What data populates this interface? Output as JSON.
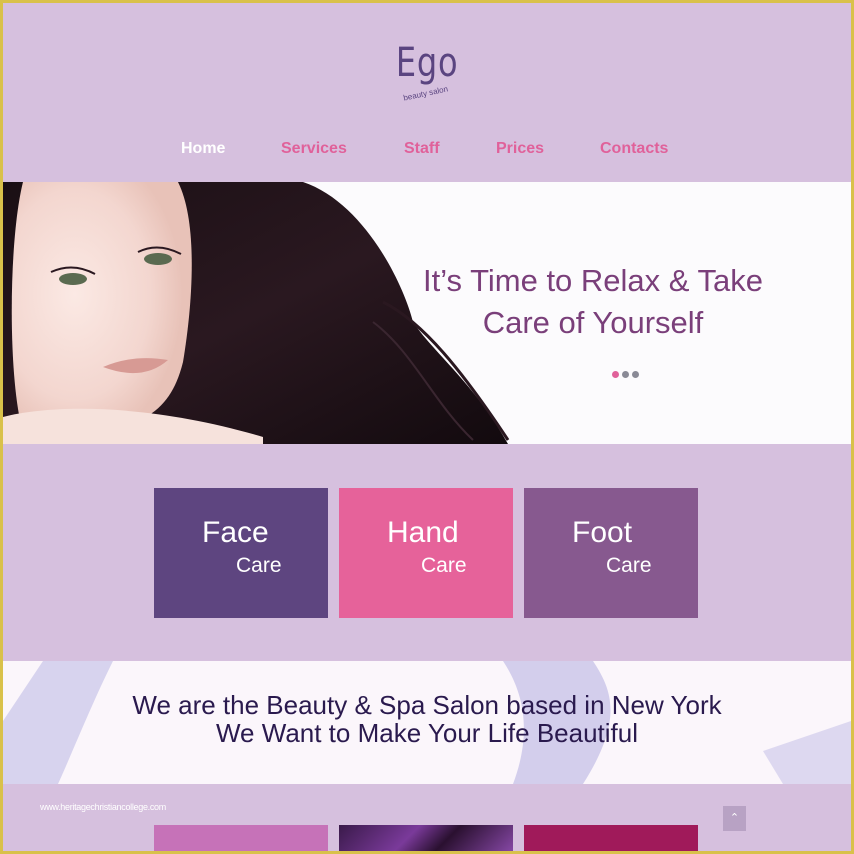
{
  "brand": {
    "name": "Ego",
    "tagline": "beauty salon"
  },
  "nav": {
    "items": [
      {
        "label": "Home",
        "active": true
      },
      {
        "label": "Services",
        "active": false
      },
      {
        "label": "Staff",
        "active": false
      },
      {
        "label": "Prices",
        "active": false
      },
      {
        "label": "Contacts",
        "active": false
      }
    ]
  },
  "hero": {
    "title_line1": "It’s Time to Relax & Take",
    "title_line2": "Care of Yourself",
    "slides": 3,
    "active_slide": 1
  },
  "services": [
    {
      "title": "Face",
      "subtitle": "Care",
      "color": "#5e4580"
    },
    {
      "title": "Hand",
      "subtitle": "Care",
      "color": "#e6629a"
    },
    {
      "title": "Foot",
      "subtitle": "Care",
      "color": "#87598f"
    }
  ],
  "about": {
    "line1": "We are the Beauty & Spa Salon based in New York",
    "line2": "We Want to Make Your Life Beautiful"
  },
  "watermark": "www.heritagechristiancollege.com",
  "scroll_top_icon": "chevron-up-icon",
  "colors": {
    "background": "#d6c0de",
    "accent_pink": "#e0619a",
    "brand_purple": "#5a4480",
    "frame_border": "#d9c14a"
  }
}
